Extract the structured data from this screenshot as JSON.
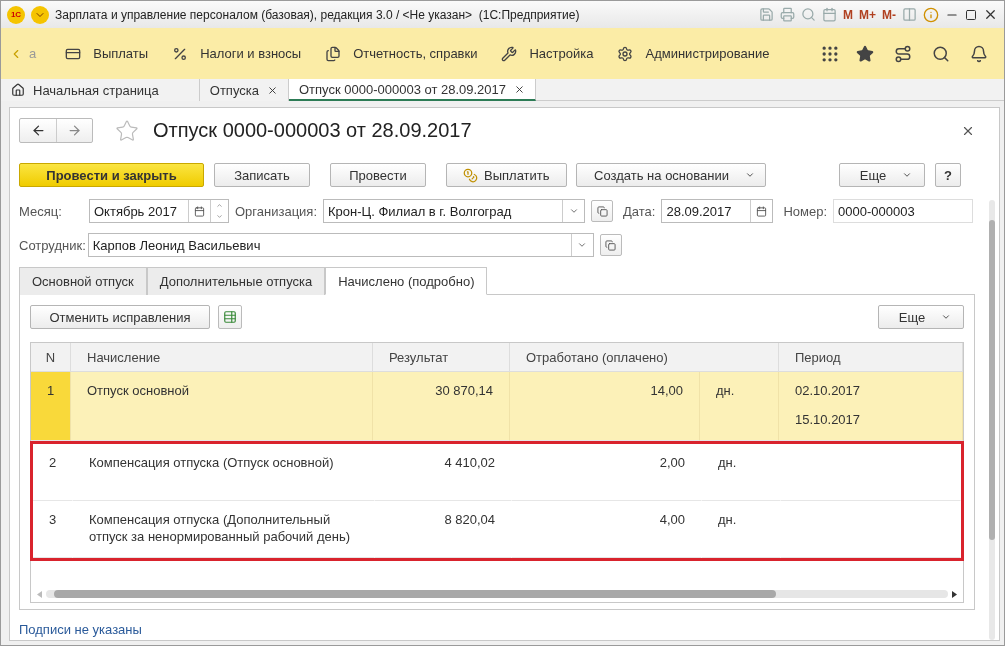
{
  "window": {
    "title": "Зарплата и управление персоналом (базовая), редакция 3.0 / <Не указан>  (1С:Предприятие)",
    "logo": "1С",
    "memory_buttons": [
      "M",
      "M+",
      "M-"
    ]
  },
  "menu": {
    "cut_item": "а",
    "items": [
      "Выплаты",
      "Налоги и взносы",
      "Отчетность, справки",
      "Настройка",
      "Администрирование"
    ]
  },
  "open_tabs": [
    {
      "label": "Начальная страница",
      "kind": "home",
      "closable": false,
      "selected": false
    },
    {
      "label": "Отпуска",
      "kind": "plain",
      "closable": true,
      "selected": false
    },
    {
      "label": "Отпуск 0000-000003 от 28.09.2017",
      "kind": "plain",
      "closable": true,
      "selected": true
    }
  ],
  "document": {
    "title": "Отпуск 0000-000003 от 28.09.2017",
    "favorite": false
  },
  "toolbar": {
    "buttons": [
      {
        "label": "Провести и закрыть",
        "kind": "primary"
      },
      {
        "label": "Записать",
        "kind": "plain"
      },
      {
        "label": "Провести",
        "kind": "plain"
      },
      {
        "label": "Выплатить",
        "kind": "icon"
      },
      {
        "label": "Создать на основании",
        "kind": "dropdown"
      }
    ],
    "more": "Еще",
    "help": "?"
  },
  "fields": {
    "month_label": "Месяц:",
    "month": "Октябрь 2017",
    "organization_label": "Организация:",
    "organization": "Крон-Ц. Филиал в г. Волгоград",
    "date_label": "Дата:",
    "date": "28.09.2017",
    "number_label": "Номер:",
    "number": "0000-000003",
    "employee_label": "Сотрудник:",
    "employee": "Карпов Леонид Васильевич"
  },
  "form_tabs": [
    {
      "label": "Основной отпуск",
      "selected": false
    },
    {
      "label": "Дополнительные отпуска",
      "selected": false
    },
    {
      "label": "Начислено (подробно)",
      "selected": true
    }
  ],
  "table_toolbar": {
    "cancel": "Отменить исправления",
    "more": "Еще"
  },
  "table": {
    "columns": [
      "N",
      "Начисление",
      "Результат",
      "Отработано (оплачено)",
      "Период"
    ],
    "rows": [
      {
        "n": "1",
        "accrual": "Отпуск основной",
        "result": "30 870,14",
        "worked": "14,00",
        "unit": "дн.",
        "period": [
          "02.10.2017",
          "15.10.2017"
        ],
        "selected": true,
        "highlighted": false
      },
      {
        "n": "2",
        "accrual": "Компенсация отпуска (Отпуск основной)",
        "result": "4 410,02",
        "worked": "2,00",
        "unit": "дн.",
        "period": [],
        "selected": false,
        "highlighted": true
      },
      {
        "n": "3",
        "accrual": "Компенсация отпуска (Дополнительный отпуск за ненормированный рабочий день)",
        "result": "8 820,04",
        "worked": "4,00",
        "unit": "дн.",
        "period": [],
        "selected": false,
        "highlighted": true
      }
    ]
  },
  "footer_link": "Подписи не указаны"
}
